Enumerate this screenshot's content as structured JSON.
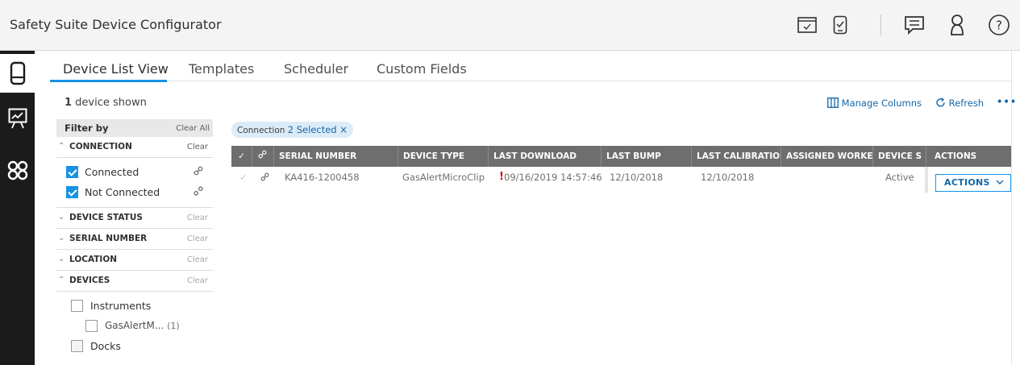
{
  "app": {
    "title": "Safety Suite Device Configurator"
  },
  "tabs": [
    {
      "label": "Device List View",
      "active": true
    },
    {
      "label": "Templates",
      "active": false
    },
    {
      "label": "Scheduler",
      "active": false
    },
    {
      "label": "Custom Fields",
      "active": false
    }
  ],
  "summary": {
    "count": "1",
    "text": " device shown"
  },
  "filter": {
    "title": "Filter by",
    "clear_all": "Clear All",
    "sections": {
      "connection": {
        "label": "CONNECTION",
        "clear": "Clear",
        "expanded": true
      },
      "device_status": {
        "label": "DEVICE STATUS",
        "clear": "Clear"
      },
      "serial_number": {
        "label": "SERIAL NUMBER",
        "clear": "Clear"
      },
      "location": {
        "label": "LOCATION",
        "clear": "Clear"
      },
      "devices": {
        "label": "DEVICES",
        "clear": "Clear",
        "expanded": true
      }
    },
    "connection_options": [
      {
        "label": "Connected",
        "checked": true,
        "icon": "link-icon"
      },
      {
        "label": "Not Connected",
        "checked": true,
        "icon": "broken-link-icon"
      }
    ],
    "device_options": {
      "instruments": {
        "label": "Instruments",
        "checked": false
      },
      "gasalert": {
        "label": "GasAlertM...",
        "count": "(1)",
        "checked": false
      },
      "docks": {
        "label": "Docks",
        "checked": false
      }
    }
  },
  "chip": {
    "prefix": "Connection",
    "value": "2 Selected",
    "close": "×"
  },
  "toolbar": {
    "manage_columns": "Manage Columns",
    "refresh": "Refresh",
    "more": "•••"
  },
  "table": {
    "headers": [
      "SERIAL NUMBER",
      "DEVICE TYPE",
      "LAST DOWNLOAD",
      "LAST BUMP",
      "LAST CALIBRATION",
      "ASSIGNED WORKER",
      "DEVICE S",
      "ACTIONS"
    ],
    "rows": [
      {
        "serial": "KA416-1200458",
        "type": "GasAlertMicroClip",
        "alert": "!",
        "last_download": "09/16/2019 14:57:46",
        "last_bump": "12/10/2018",
        "last_calibration": "12/10/2018",
        "assigned_worker": "",
        "status": "Active",
        "action_label": "ACTIONS"
      }
    ]
  },
  "colors": {
    "accent": "#1792e5",
    "rail": "#1b1b1b",
    "header": "#6e6e6e",
    "alert": "#d00000"
  }
}
